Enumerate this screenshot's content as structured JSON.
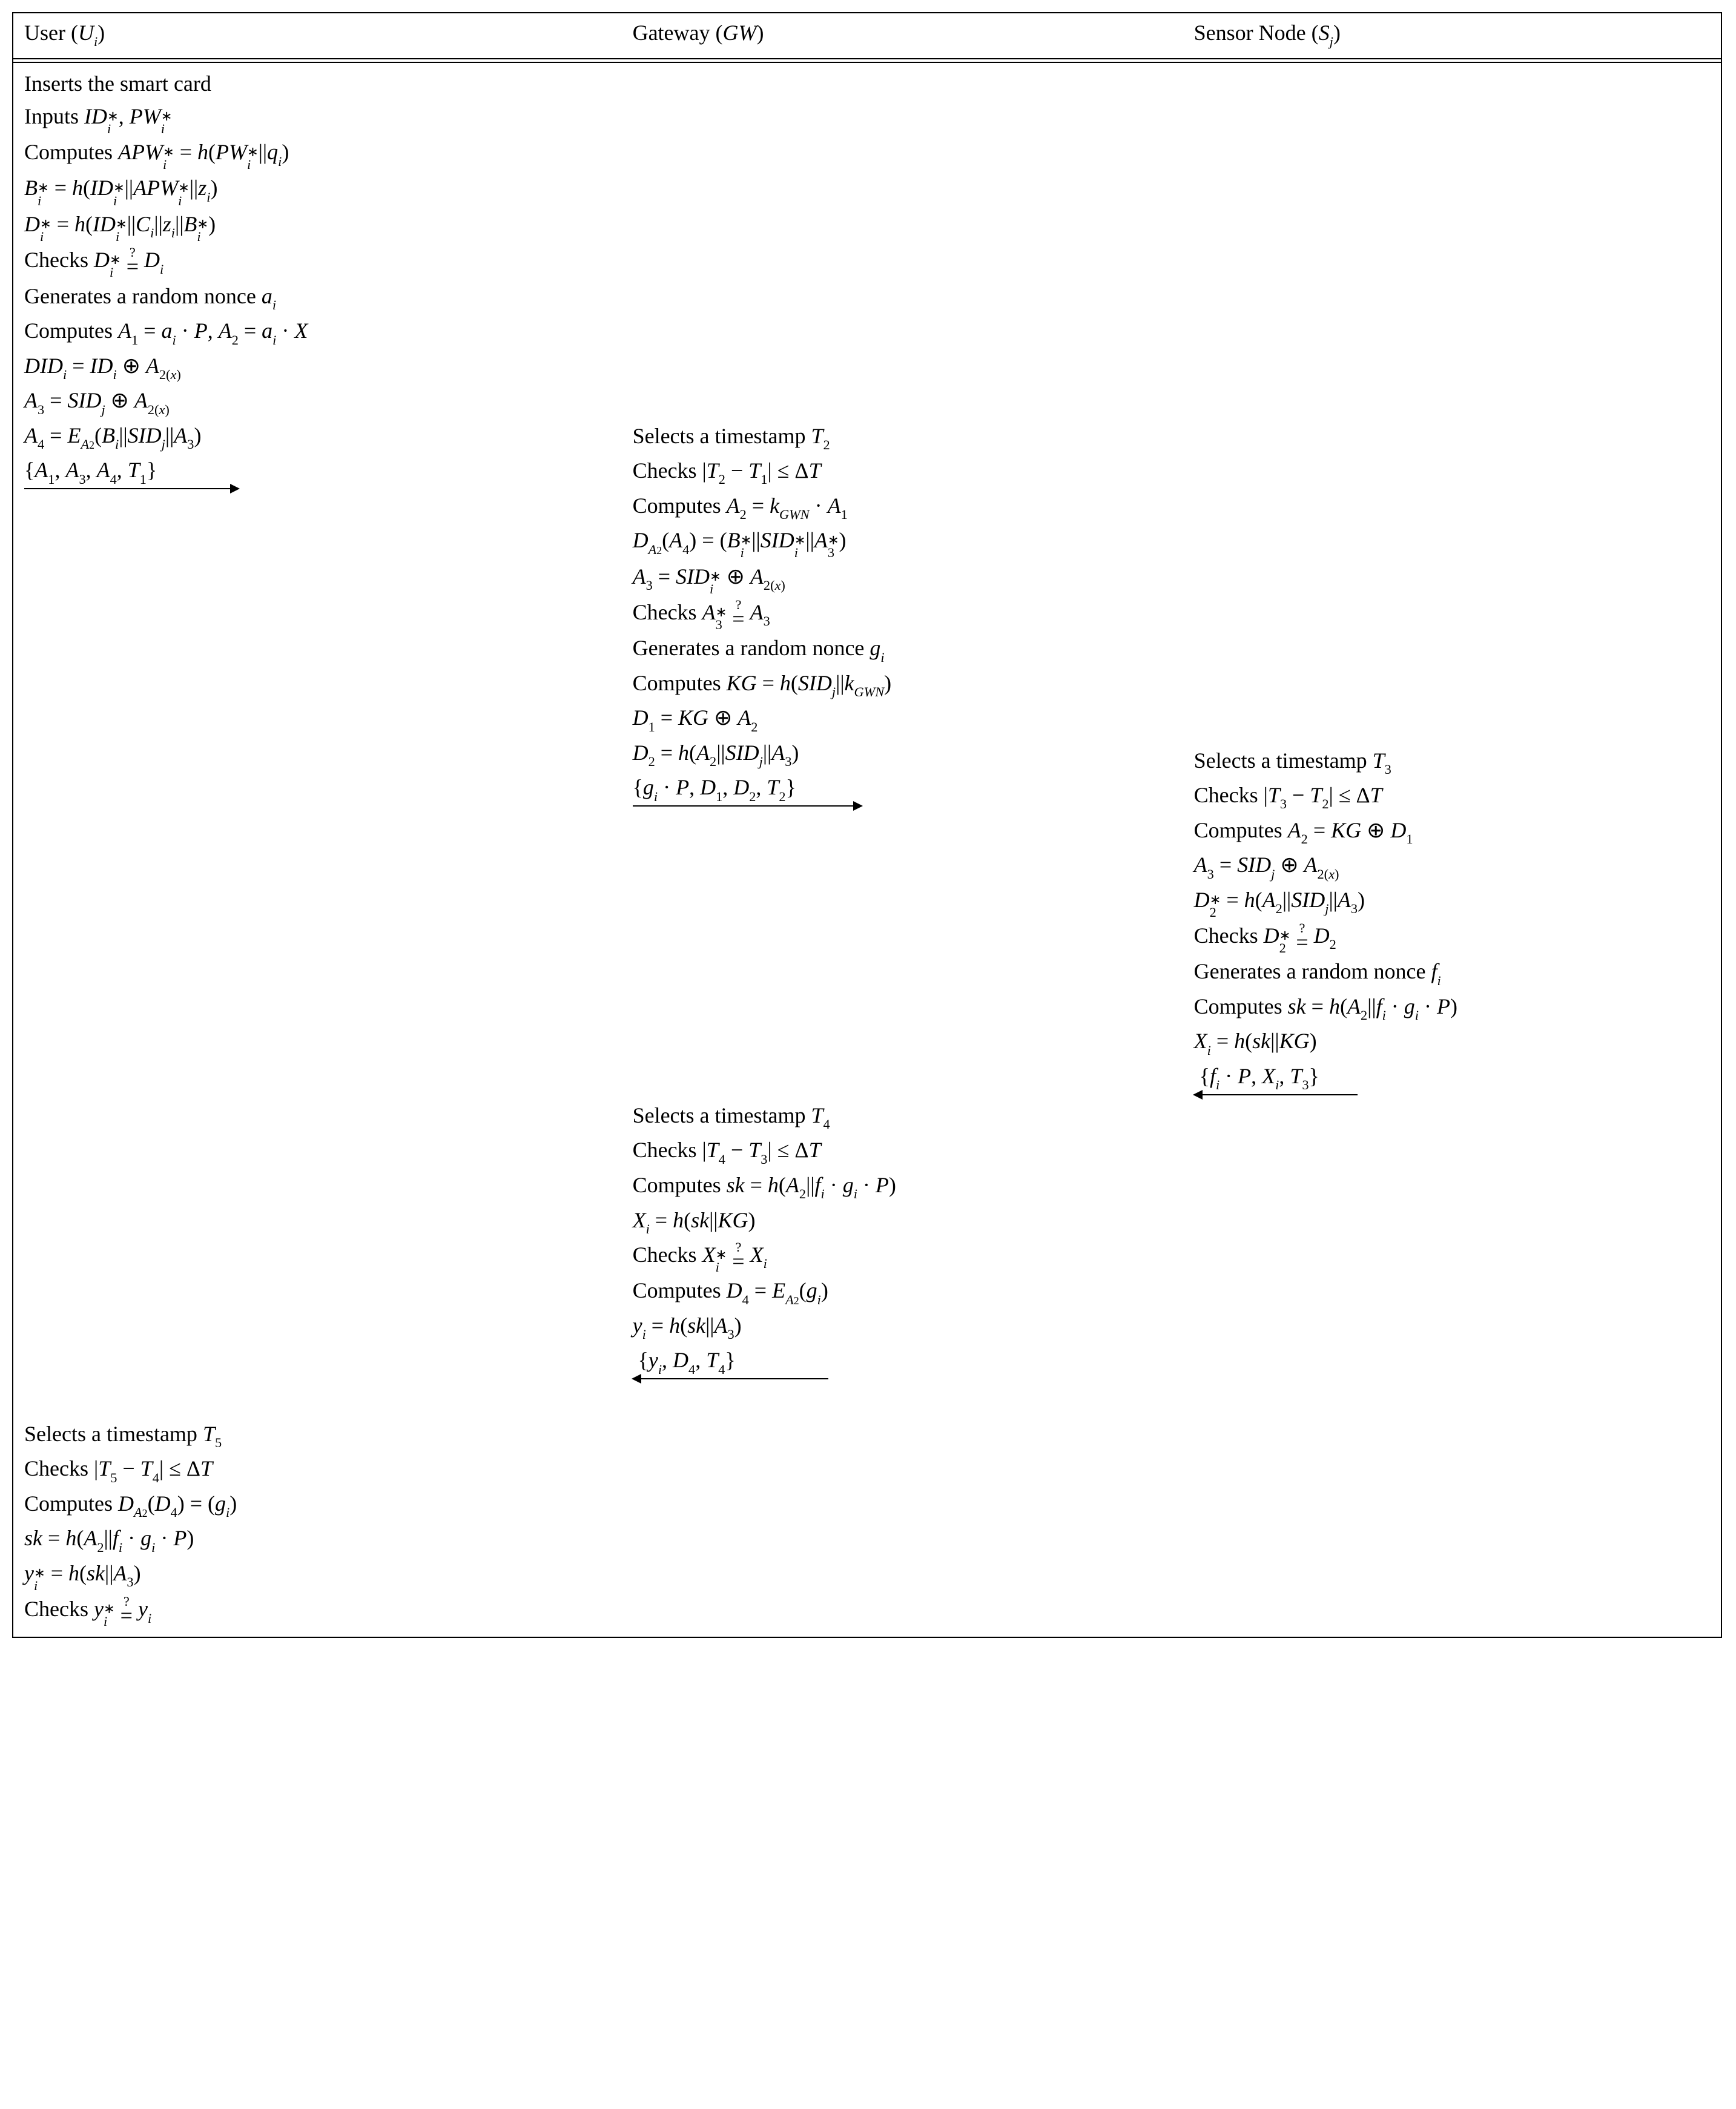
{
  "headers": {
    "user": "User (Uᵢ)",
    "gw": "Gateway (GW)",
    "sensor": "Sensor Node (Sⱼ)"
  },
  "user": {
    "l1": "Inserts the smart card",
    "l2": "Inputs IDᵢ*, PWᵢ*",
    "l3": "Computes APWᵢ* = h(PWᵢ* || qᵢ)",
    "l4": "Bᵢ* = h(IDᵢ* || APWᵢ* || zᵢ)",
    "l5": "Dᵢ* = h(IDᵢ* || Cᵢ || zᵢ || Bᵢ*)",
    "l6": "Checks Dᵢ* ≟ Dᵢ",
    "l7": "Generates a random nonce aᵢ",
    "l8": "Computes A₁ = aᵢ · P, A₂ = aᵢ · X",
    "l9": "DIDᵢ = IDᵢ ⊕ A₂₍ₓ₎",
    "l10": "A₃ = SIDⱼ ⊕ A₂₍ₓ₎",
    "l11": "A₄ = E_A₂(Bᵢ || SIDⱼ || A₃)",
    "l12": "{A₁, A₃, A₄, T₁}",
    "l13": "Selects a timestamp T₅",
    "l14": "Checks |T₅ − T₄| ≤ ΔT",
    "l15": "Computes D_A₂(D₄) = (gᵢ)",
    "l16": "sk = h(A₂ || fᵢ · gᵢ · P)",
    "l17": "yᵢ* = h(sk || A₃)",
    "l18": "Checks yᵢ* ≟ yᵢ"
  },
  "gw": {
    "b1l1": "Selects a timestamp T₂",
    "b1l2": "Checks |T₂ − T₁| ≤ ΔT",
    "b1l3": "Computes A₂ = k_GWN · A₁",
    "b1l4": "D_A₂(A₄) = (Bᵢ* || SIDᵢ* || A₃*)",
    "b1l5": "A₃ = SIDᵢ* ⊕ A₂₍ₓ₎",
    "b1l6": "Checks A₃* ≟ A₃",
    "b1l7": "Generates a random nonce gᵢ",
    "b1l8": "Computes KG = h(SIDⱼ || k_GWN)",
    "b1l9": "D₁ = KG ⊕ A₂",
    "b1l10": "D₂ = h(A₂ || SIDⱼ || A₃)",
    "b1l11": "{gᵢ · P, D₁, D₂, T₂}",
    "b2l1": "Selects a timestamp T₄",
    "b2l2": "Checks |T₄ − T₃| ≤ ΔT",
    "b2l3": "Computes sk = h(A₂ || fᵢ · gᵢ · P)",
    "b2l4": "Xᵢ = h(sk || KG)",
    "b2l5": "Checks Xᵢ* ≟ Xᵢ",
    "b2l6": "Computes D₄ = E_A₂(gᵢ)",
    "b2l7": "yᵢ = h(sk || A₃)",
    "b2l8": "{yᵢ, D₄, T₄}"
  },
  "sensor": {
    "l1": "Selects a timestamp T₃",
    "l2": "Checks |T₃ − T₂| ≤ ΔT",
    "l3": "Computes A₂ = KG ⊕ D₁",
    "l4": "A₃ = SIDⱼ ⊕ A₂₍ₓ₎",
    "l5": "D₂* = h(A₂ || SIDⱼ || A₃)",
    "l6": "Checks D₂* ≟ D₂",
    "l7": "Generates a random nonce fᵢ",
    "l8": "Computes sk = h(A₂ || fᵢ · gᵢ · P)",
    "l9": "Xᵢ = h(sk || KG)",
    "l10": "{fᵢ · P, Xᵢ, T₃}"
  }
}
